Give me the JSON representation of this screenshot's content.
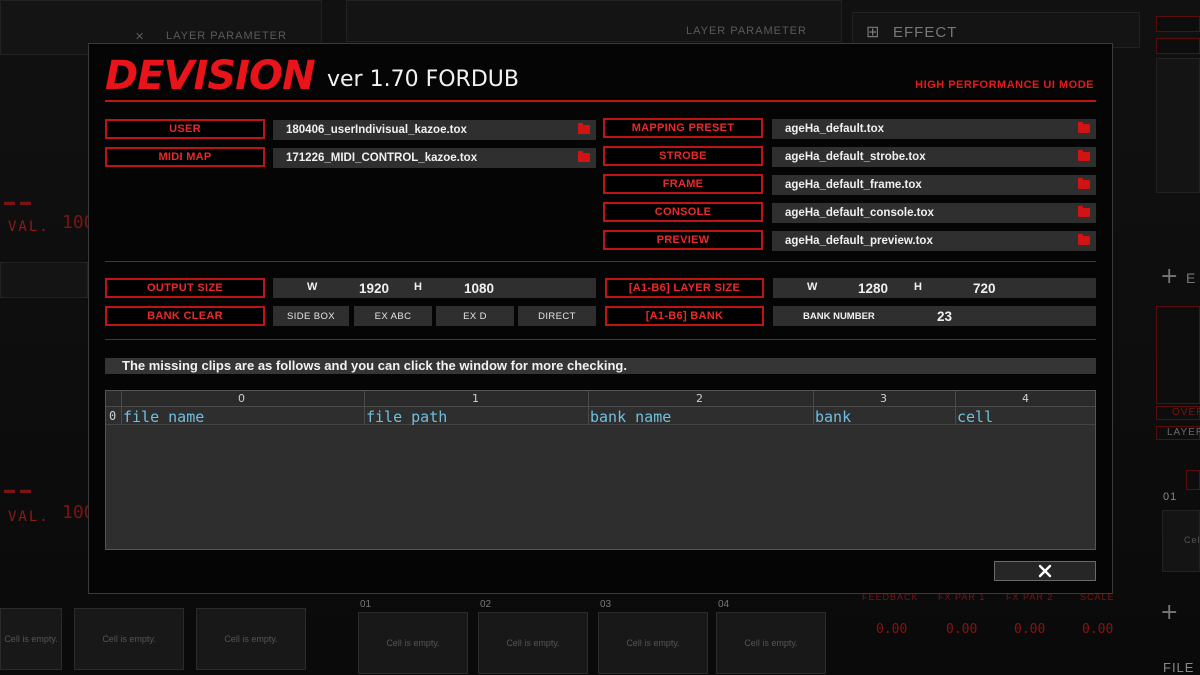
{
  "background": {
    "layer_parameter_label": "LAYER PARAMETER",
    "effect_label": "EFFECT",
    "val_label": "VAL.",
    "val_value": "100",
    "empty_cell_text": "Cell is empty.",
    "cell_numbers": [
      "01",
      "02",
      "03",
      "04"
    ],
    "fx_labels": [
      "FEEDBACK",
      "FX PAR 1",
      "FX PAR 2",
      "SCALE"
    ],
    "fx_values": [
      "0.00",
      "0.00",
      "0.00",
      "0.00"
    ],
    "side_labels": [
      "OVER",
      "LAYER"
    ],
    "file_label": "FILE",
    "side_cell_number": "01",
    "side_cell_text": "Cell"
  },
  "dialog": {
    "logo": "DEVISION",
    "version": "ver 1.70 FORDUB",
    "mode_label": "HIGH PERFORMANCE UI MODE",
    "user": {
      "label": "USER",
      "value": "180406_userIndivisual_kazoe.tox"
    },
    "midi_map": {
      "label": "MIDI MAP",
      "value": "171226_MIDI_CONTROL_kazoe.tox"
    },
    "presets": [
      {
        "label": "MAPPING PRESET",
        "value": "ageHa_default.tox"
      },
      {
        "label": "STROBE",
        "value": "ageHa_default_strobe.tox"
      },
      {
        "label": "FRAME",
        "value": "ageHa_default_frame.tox"
      },
      {
        "label": "CONSOLE",
        "value": "ageHa_default_console.tox"
      },
      {
        "label": "PREVIEW",
        "value": "ageHa_default_preview.tox"
      }
    ],
    "output_size": {
      "label": "OUTPUT SIZE",
      "w_label": "W",
      "w": "1920",
      "h_label": "H",
      "h": "1080"
    },
    "layer_size": {
      "label": "[A1-B6] LAYER SIZE",
      "w_label": "W",
      "w": "1280",
      "h_label": "H",
      "h": "720"
    },
    "bank_clear": {
      "label": "BANK CLEAR",
      "buttons": [
        "SIDE BOX",
        "EX ABC",
        "EX D",
        "DIRECT"
      ]
    },
    "bank": {
      "label": "[A1-B6] BANK",
      "number_label": "BANK NUMBER",
      "number": "23"
    },
    "missing_message": "The missing clips are as follows and you can click the window for more checking.",
    "table": {
      "column_indices": [
        "0",
        "1",
        "2",
        "3",
        "4"
      ],
      "row_index": "0",
      "cells": [
        "file name",
        "file path",
        "bank name",
        "bank",
        "cell"
      ]
    }
  }
}
